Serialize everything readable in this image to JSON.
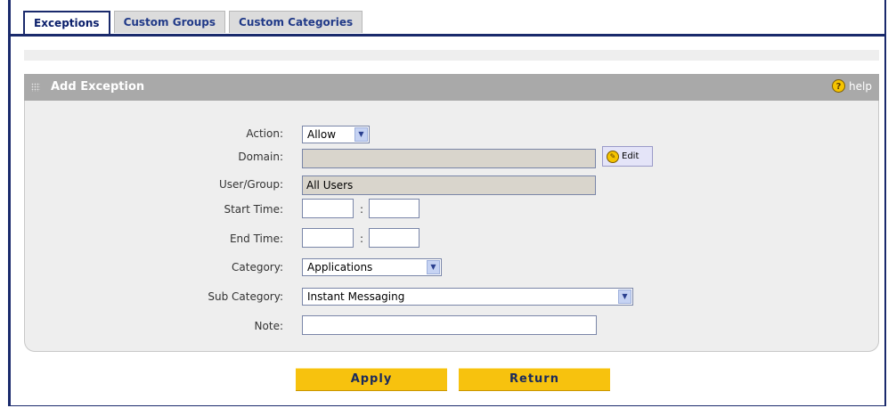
{
  "tabs": [
    {
      "label": "Exceptions",
      "active": true
    },
    {
      "label": "Custom Groups",
      "active": false
    },
    {
      "label": "Custom Categories",
      "active": false
    }
  ],
  "panel": {
    "title": "Add Exception",
    "help_label": "help",
    "help_icon": "question-icon"
  },
  "form": {
    "action": {
      "label": "Action:",
      "value": "Allow"
    },
    "domain": {
      "label": "Domain:",
      "value": "",
      "edit_label": "Edit"
    },
    "user_group": {
      "label": "User/Group:",
      "value": "All Users"
    },
    "start_time": {
      "label": "Start Time:",
      "hour": "",
      "minute": "",
      "separator": ":"
    },
    "end_time": {
      "label": "End Time:",
      "hour": "",
      "minute": "",
      "separator": ":"
    },
    "category": {
      "label": "Category:",
      "value": "Applications"
    },
    "sub_category": {
      "label": "Sub Category:",
      "value": "Instant Messaging"
    },
    "note": {
      "label": "Note:",
      "value": ""
    }
  },
  "buttons": {
    "apply": "Apply",
    "return": "Return"
  },
  "colors": {
    "accent_navy": "#1a2a6c",
    "button_yellow": "#f7c20e",
    "panel_header": "#a9a9a9",
    "panel_body": "#eeeeee"
  }
}
